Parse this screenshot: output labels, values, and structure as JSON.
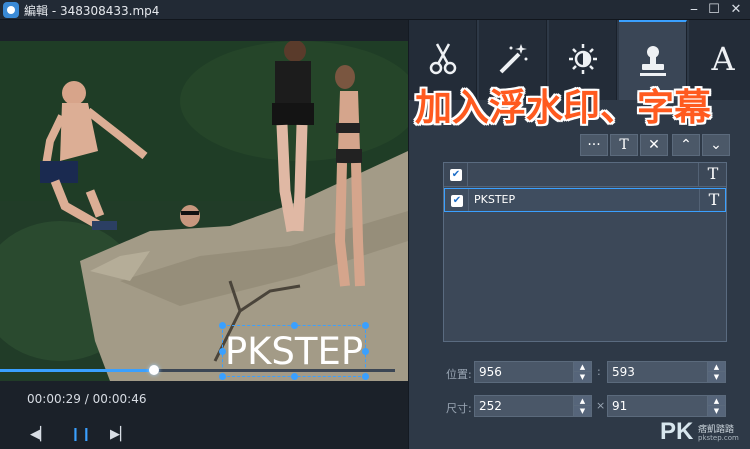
{
  "window": {
    "title": "編輯 - 348308433.mp4",
    "minimize_glyph": "⎯",
    "maximize_glyph": "☐",
    "close_glyph": "✕"
  },
  "video": {
    "watermark_text": "PKSTEP",
    "progress": 0.39,
    "timecode": "00:00:29 / 00:00:46"
  },
  "controls": {
    "prev_glyph": "◀▏",
    "pause_glyph": "❙❙",
    "next_glyph": "▶▏"
  },
  "tabs": [
    {
      "name": "scissors-icon"
    },
    {
      "name": "magic-wand-icon"
    },
    {
      "name": "brightness-icon"
    },
    {
      "name": "stamp-icon",
      "active": true
    },
    {
      "name": "text-icon",
      "letter": "A"
    }
  ],
  "overlay_caption": "加入浮水印、字幕",
  "toolbar": {
    "more_label": "···",
    "text_label": "T",
    "delete_label": "✕",
    "up_label": "⌃",
    "down_label": "⌄"
  },
  "watermark_list": [
    {
      "checked": true,
      "label": "",
      "type_glyph": "T"
    },
    {
      "checked": true,
      "label": "PKSTEP",
      "type_glyph": "T",
      "selected": true
    }
  ],
  "checkbox_glyph": "✔",
  "position": {
    "label": "位置:",
    "x": "956",
    "y": "593",
    "separator": ":"
  },
  "size": {
    "label": "尺寸:",
    "w": "252",
    "h": "91",
    "separator": "×"
  },
  "spinner": {
    "up": "▲",
    "down": "▼"
  },
  "logo": {
    "text": "PK",
    "subtitle": "痞凱踏踏",
    "url": "pkstep.com"
  },
  "colors": {
    "accent": "#3aa0ff",
    "caption": "#ff5a1f",
    "panel": "#2e3947"
  }
}
